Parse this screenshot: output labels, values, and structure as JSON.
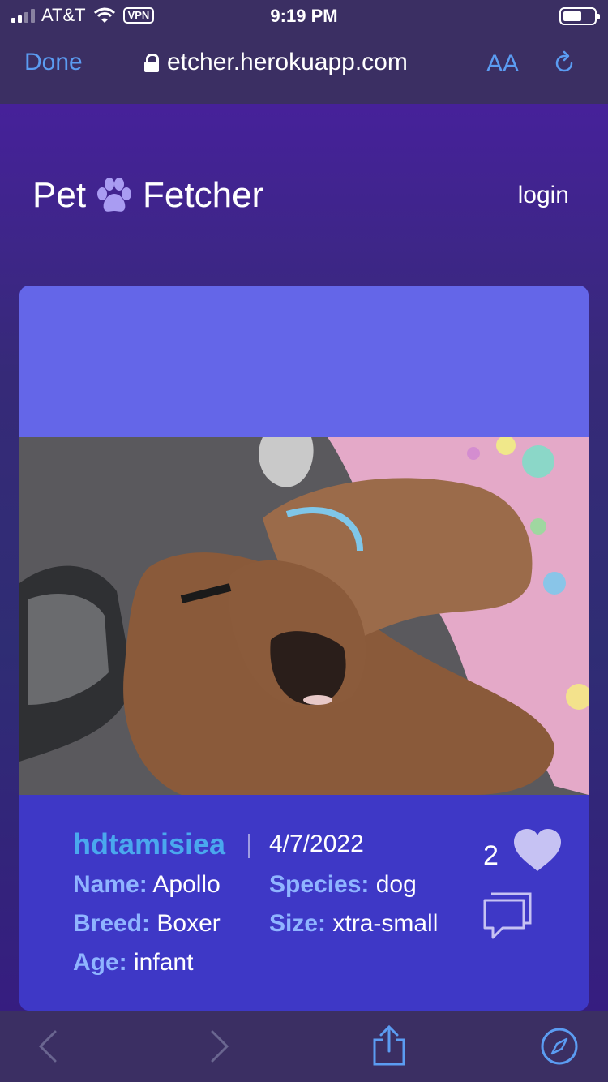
{
  "status_bar": {
    "carrier": "AT&T",
    "vpn": "VPN",
    "time": "9:19 PM"
  },
  "browser": {
    "done_label": "Done",
    "url": "etcher.herokuapp.com",
    "text_size_label": "AA",
    "accent_color": "#5b9cf2"
  },
  "header": {
    "brand_left": "Pet",
    "brand_right": "Fetcher",
    "login_label": "login"
  },
  "post": {
    "username": "hdtamisiea",
    "date": "4/7/2022",
    "likes": "2",
    "fields": {
      "name_label": "Name:",
      "name_value": "Apollo",
      "species_label": "Species:",
      "species_value": "dog",
      "breed_label": "Breed:",
      "breed_value": "Boxer",
      "size_label": "Size:",
      "size_value": "xtra-small",
      "age_label": "Age:",
      "age_value": "infant"
    }
  },
  "icons": {
    "brand": "paw-icon",
    "like": "heart-icon",
    "comments": "comment-icon",
    "toolbar": [
      "back-icon",
      "forward-icon",
      "share-icon",
      "compass-icon"
    ]
  }
}
